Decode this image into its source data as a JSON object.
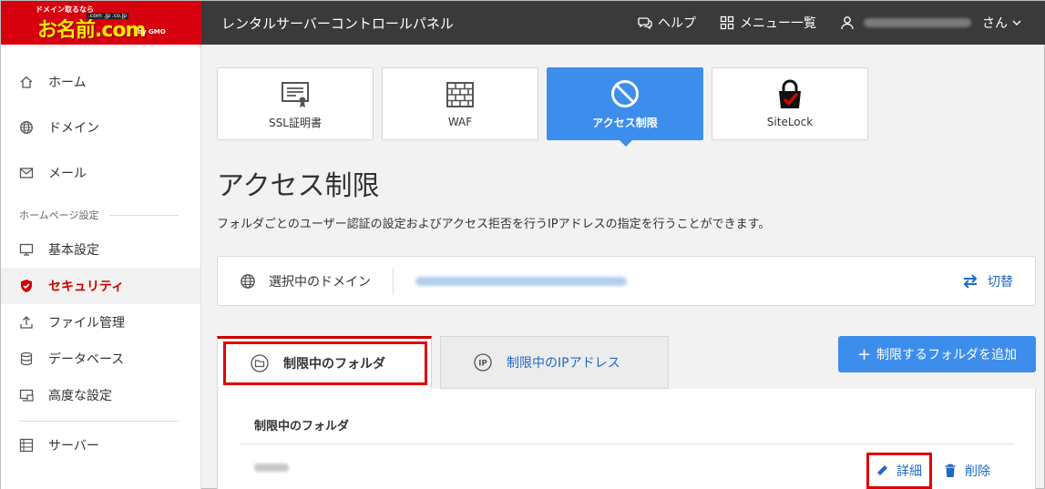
{
  "brand": {
    "tagline": "ドメイン取るなら",
    "name": "お名前.com",
    "tlds": ".com .jp .co.jp",
    "gmo": "by GMO"
  },
  "header": {
    "title": "レンタルサーバーコントロールパネル",
    "help_label": "ヘルプ",
    "menu_label": "メニュー一覧",
    "user_suffix": "さん"
  },
  "sidebar": {
    "items_top": [
      {
        "label": "ホーム",
        "icon": "home-icon"
      },
      {
        "label": "ドメイン",
        "icon": "globe-icon"
      },
      {
        "label": "メール",
        "icon": "mail-icon"
      }
    ],
    "section_label": "ホームページ設定",
    "items_site": [
      {
        "label": "基本設定",
        "icon": "monitor-icon"
      },
      {
        "label": "セキュリティ",
        "icon": "shield-icon",
        "active": true
      },
      {
        "label": "ファイル管理",
        "icon": "upload-icon"
      },
      {
        "label": "データベース",
        "icon": "database-icon"
      },
      {
        "label": "高度な設定",
        "icon": "advanced-icon"
      }
    ],
    "items_bottom": [
      {
        "label": "サーバー",
        "icon": "server-icon"
      }
    ]
  },
  "service_tabs": [
    {
      "label": "SSL証明書",
      "icon": "certificate-icon"
    },
    {
      "label": "WAF",
      "icon": "firewall-icon"
    },
    {
      "label": "アクセス制限",
      "icon": "prohibited-icon",
      "active": true
    },
    {
      "label": "SiteLock",
      "icon": "sitelock-icon"
    }
  ],
  "page": {
    "title": "アクセス制限",
    "description": "フォルダごとのユーザー認証の設定およびアクセス拒否を行うIPアドレスの指定を行うことができます。"
  },
  "domain": {
    "label": "選択中のドメイン",
    "switch_label": "切替"
  },
  "content_tabs": {
    "folders_label": "制限中のフォルダ",
    "ip_label": "制限中のIPアドレス"
  },
  "add_button_label": "制限するフォルダを追加",
  "panel": {
    "header": "制限中のフォルダ",
    "edit_label": "詳細",
    "delete_label": "削除"
  },
  "colors": {
    "brand_red": "#d6000f",
    "accent_blue": "#3d8ded",
    "link_blue": "#1f68c6",
    "highlight_red": "#e00000"
  }
}
